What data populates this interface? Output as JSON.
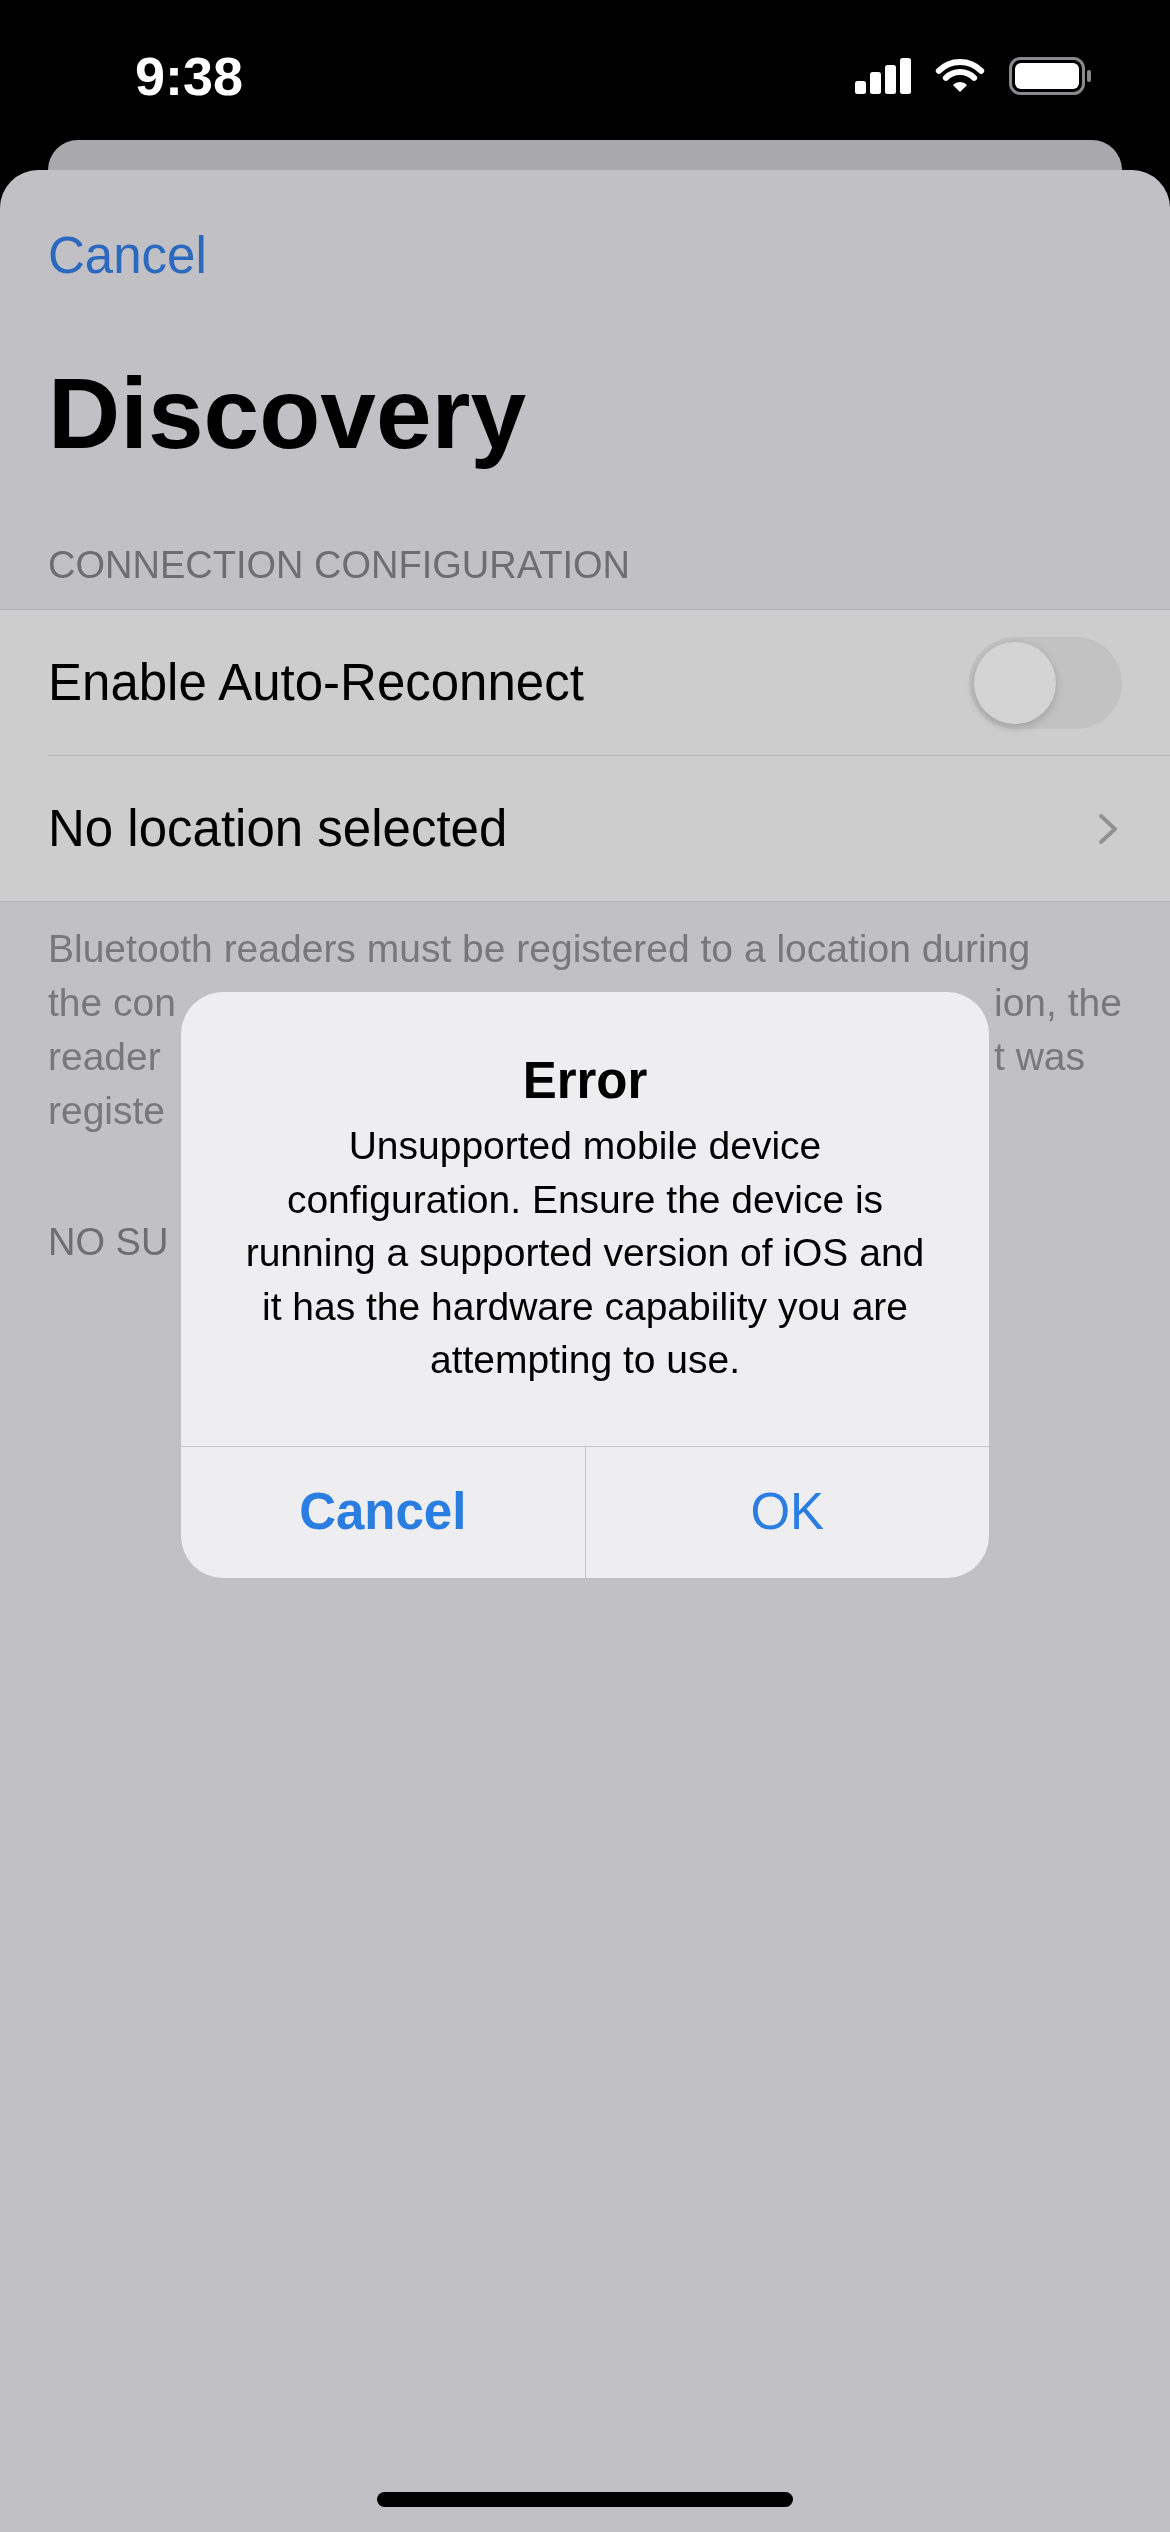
{
  "status_bar": {
    "time": "9:38"
  },
  "nav": {
    "cancel": "Cancel",
    "title": "Discovery"
  },
  "sections": [
    {
      "header": "CONNECTION CONFIGURATION",
      "rows": [
        {
          "kind": "toggle",
          "label": "Enable Auto-Reconnect",
          "on": false
        },
        {
          "kind": "disclosure",
          "label": "No location selected"
        }
      ],
      "footer_lines": [
        {
          "start": "Bluetooth readers must be registered to a location during"
        },
        {
          "start": "the con",
          "end": "ion, the"
        },
        {
          "start": "reader",
          "end": "t was"
        },
        {
          "start": "registe"
        }
      ]
    },
    {
      "header": "NO SU"
    }
  ],
  "alert": {
    "title": "Error",
    "message": "Unsupported mobile device configuration. Ensure the device is running a supported version of iOS and it has the hardware capability you are attempting to use.",
    "buttons": [
      {
        "label": "Cancel",
        "preferred": true
      },
      {
        "label": "OK",
        "preferred": false
      }
    ]
  }
}
